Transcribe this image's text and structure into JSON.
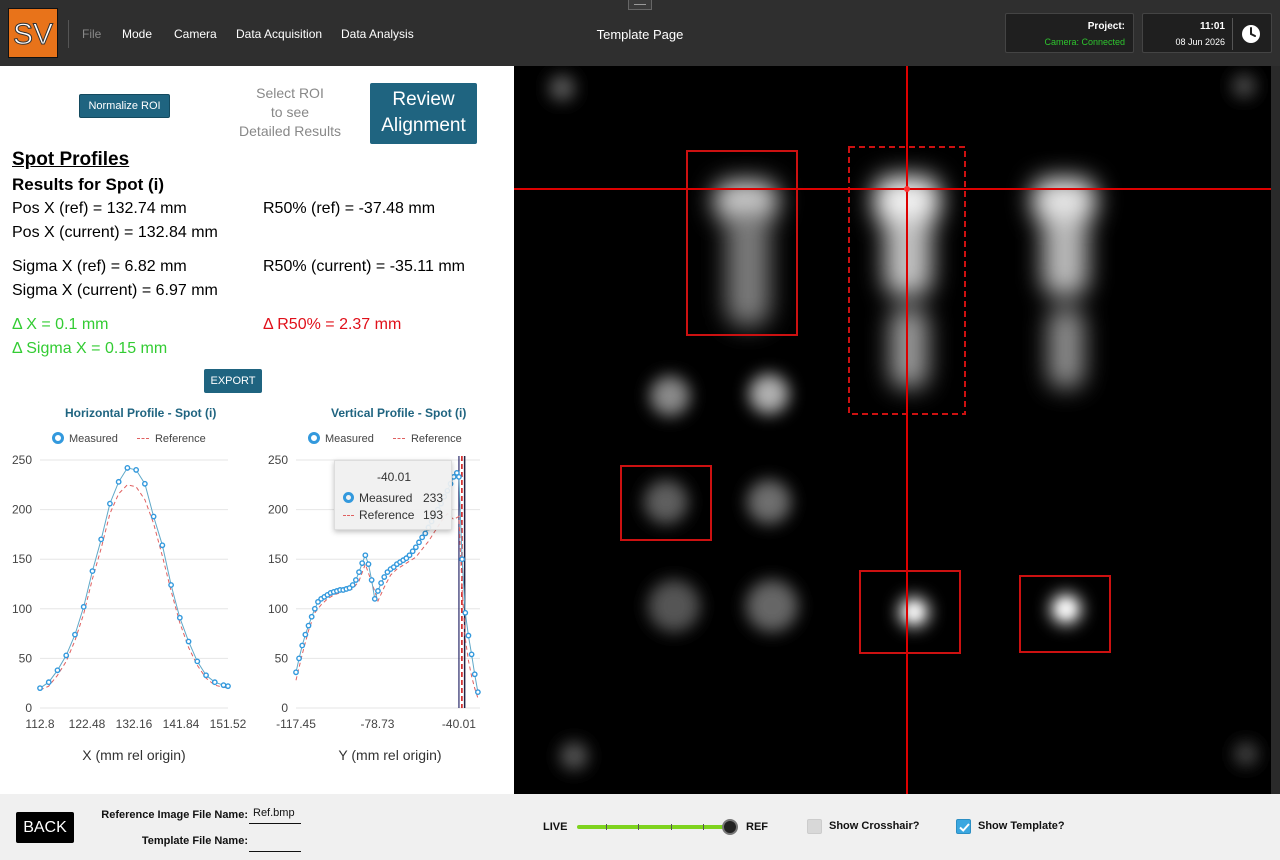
{
  "header": {
    "logo_text": "SV",
    "menu": [
      "File",
      "Mode",
      "Camera",
      "Data Acquisition",
      "Data Analysis"
    ],
    "title": "Template Page",
    "project_label": "Project:",
    "camera_status": "Camera: Connected",
    "time": "11:01",
    "date": "08 Jun 2026"
  },
  "controls": {
    "normalize_label": "Normalize ROI",
    "select_roi_hint": [
      "Select ROI",
      "to see",
      "Detailed Results"
    ],
    "review_label": [
      "Review",
      "Alignment"
    ],
    "export_label": "EXPORT"
  },
  "results": {
    "section_title": "Spot Profiles",
    "subtitle": "Results for Spot (i)",
    "pos_x_ref": "Pos X (ref)  = 132.74 mm",
    "pos_x_current": "Pos X (current) = 132.84 mm",
    "r50_ref": "R50% (ref) = -37.48 mm",
    "sigma_x_ref": "Sigma X (ref)  = 6.82 mm",
    "sigma_x_current": "Sigma X (current) = 6.97 mm",
    "r50_current": "R50% (current) = -35.11 mm",
    "delta_x": "Δ X = 0.1 mm",
    "delta_sigma": "Δ Sigma X = 0.15 mm",
    "delta_r50": "Δ R50% = 2.37 mm"
  },
  "colors": {
    "accent": "#1f6480",
    "ok": "#33cc33",
    "bad": "#e0101a",
    "measured": "#3399dd",
    "reference": "#e06060",
    "roi": "#cc1111"
  },
  "chart_data": [
    {
      "type": "line",
      "title": "Horizontal Profile - Spot (i)",
      "xlabel": "X (mm rel origin)",
      "ylabel": "",
      "ylim": [
        0,
        250
      ],
      "xlim": [
        112.8,
        151.52
      ],
      "x_ticks": [
        "112.8",
        "122.48",
        "132.16",
        "141.84",
        "151.52"
      ],
      "y_ticks": [
        "0",
        "50",
        "100",
        "150",
        "200",
        "250"
      ],
      "legend": [
        "Measured",
        "Reference"
      ],
      "series": [
        {
          "name": "Measured",
          "x": [
            112.8,
            114.6,
            116.4,
            118.2,
            120.0,
            121.8,
            123.6,
            125.4,
            127.2,
            129.0,
            130.8,
            132.6,
            134.4,
            136.2,
            138.0,
            139.8,
            141.6,
            143.4,
            145.2,
            147.0,
            148.8,
            150.6,
            151.52
          ],
          "y": [
            20,
            26,
            38,
            53,
            74,
            102,
            138,
            170,
            206,
            228,
            242,
            240,
            226,
            193,
            164,
            124,
            91,
            67,
            47,
            33,
            26,
            23,
            22
          ]
        },
        {
          "name": "Reference",
          "x": [
            112.8,
            114.6,
            116.4,
            118.2,
            120.0,
            121.8,
            123.6,
            125.4,
            127.2,
            129.0,
            130.8,
            132.6,
            134.4,
            136.2,
            138.0,
            139.8,
            141.6,
            143.4,
            145.2,
            147.0,
            148.8,
            150.6,
            151.52
          ],
          "y": [
            18,
            22,
            33,
            47,
            68,
            95,
            130,
            161,
            196,
            216,
            225,
            223,
            210,
            186,
            153,
            118,
            86,
            61,
            43,
            30,
            23,
            21,
            20
          ]
        }
      ]
    },
    {
      "type": "line",
      "title": "Vertical Profile - Spot (i)",
      "xlabel": "Y (mm rel origin)",
      "ylabel": "",
      "ylim": [
        0,
        250
      ],
      "xlim": [
        -117.45,
        -30.0
      ],
      "x_ticks": [
        "-117.45",
        "-78.73",
        "-40.01"
      ],
      "y_ticks": [
        "0",
        "50",
        "100",
        "150",
        "200",
        "250"
      ],
      "legend": [
        "Measured",
        "Reference"
      ],
      "series": [
        {
          "name": "Measured",
          "x": [
            -117.45,
            -116.0,
            -114.5,
            -113.0,
            -111.5,
            -110.0,
            -108.5,
            -107.0,
            -105.5,
            -104.0,
            -102.5,
            -101.0,
            -99.5,
            -98.0,
            -96.5,
            -95.0,
            -93.5,
            -92.0,
            -90.5,
            -89.0,
            -87.5,
            -86.0,
            -84.5,
            -83.0,
            -81.5,
            -80.0,
            -78.5,
            -77.0,
            -75.5,
            -74.0,
            -72.5,
            -71.0,
            -69.5,
            -68.0,
            -66.5,
            -65.0,
            -63.5,
            -62.0,
            -60.5,
            -59.0,
            -57.5,
            -56.0,
            -54.5,
            -53.0,
            -51.5,
            -50.0,
            -48.5,
            -47.0,
            -45.5,
            -44.0,
            -42.5,
            -41.0,
            -40.01,
            -38.5,
            -37.0,
            -35.5,
            -34.0,
            -32.5,
            -31.0
          ],
          "y": [
            36,
            50,
            63,
            74,
            83,
            92,
            100,
            107,
            110,
            112,
            114,
            116,
            117,
            118,
            119,
            119,
            120,
            121,
            124,
            129,
            137,
            146,
            154,
            145,
            129,
            110,
            118,
            126,
            132,
            137,
            140,
            142,
            145,
            147,
            149,
            151,
            154,
            158,
            162,
            167,
            172,
            176,
            182,
            188,
            194,
            200,
            206,
            213,
            219,
            226,
            233,
            237,
            233,
            150,
            96,
            73,
            54,
            34,
            16
          ]
        },
        {
          "name": "Reference",
          "x": [
            -117.45,
            -114.5,
            -111.5,
            -108.5,
            -105.5,
            -102.5,
            -99.5,
            -96.5,
            -93.5,
            -90.5,
            -87.5,
            -84.5,
            -81.5,
            -78.5,
            -75.5,
            -72.5,
            -69.5,
            -66.5,
            -63.5,
            -60.5,
            -57.5,
            -54.5,
            -51.5,
            -48.5,
            -45.5,
            -42.5,
            -40.01,
            -38.5,
            -37.0,
            -35.5,
            -34.0,
            -32.5,
            -31.0
          ],
          "y": [
            28,
            54,
            78,
            96,
            104,
            110,
            114,
            116,
            118,
            120,
            128,
            145,
            127,
            108,
            122,
            134,
            140,
            144,
            148,
            152,
            160,
            168,
            178,
            188,
            196,
            190,
            193,
            120,
            70,
            48,
            32,
            20,
            10
          ]
        }
      ],
      "tooltip": {
        "x_value": "-40.01",
        "measured_label": "Measured",
        "measured_value": "233",
        "reference_label": "Reference",
        "reference_value": "193"
      }
    }
  ],
  "footer": {
    "back_label": "BACK",
    "ref_image_label": "Reference Image File Name:",
    "ref_image_value": "Ref.bmp",
    "template_label": "Template File Name:",
    "template_value": "",
    "live_label": "LIVE",
    "ref_label": "REF",
    "slider_value": 1.0,
    "show_crosshair_label": "Show Crosshair?",
    "show_crosshair_checked": false,
    "show_template_label": "Show Template?",
    "show_template_checked": true
  }
}
